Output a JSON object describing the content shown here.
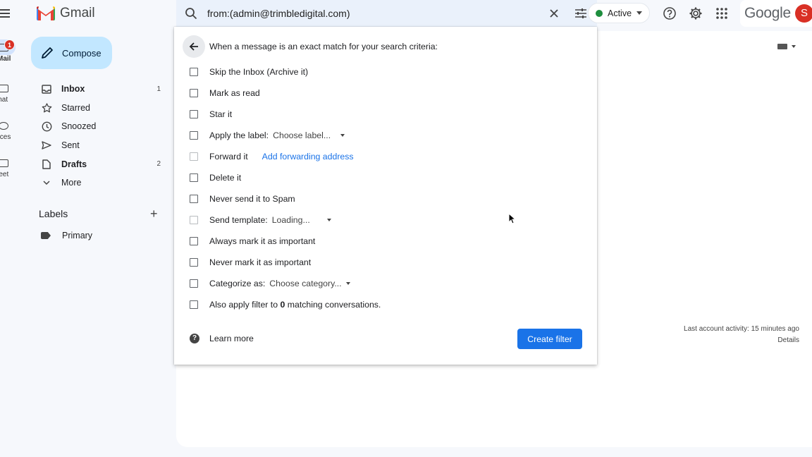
{
  "rail": {
    "mail_label": "Mail",
    "mail_badge": "1",
    "chat_label": "Chat",
    "spaces_label": "Spaces",
    "meet_label": "Meet"
  },
  "app": {
    "name": "Gmail"
  },
  "compose": {
    "label": "Compose"
  },
  "nav": [
    {
      "label": "Inbox",
      "count": "1",
      "icon": "inbox-icon"
    },
    {
      "label": "Starred",
      "count": "",
      "icon": "star-icon"
    },
    {
      "label": "Snoozed",
      "count": "",
      "icon": "clock-icon"
    },
    {
      "label": "Sent",
      "count": "",
      "icon": "send-icon"
    },
    {
      "label": "Drafts",
      "count": "2",
      "icon": "draft-icon"
    },
    {
      "label": "More",
      "count": "",
      "icon": "chevron-down-icon"
    }
  ],
  "labels": {
    "heading": "Labels",
    "items": [
      "Primary"
    ]
  },
  "search": {
    "value": "from:(admin@trimbledigital.com)"
  },
  "status": {
    "label": "Active"
  },
  "brand": {
    "google": "Google",
    "avatar_initial": "S"
  },
  "filter": {
    "title": "When a message is an exact match for your search criteria:",
    "options": {
      "skip_inbox": "Skip the Inbox (Archive it)",
      "mark_read": "Mark as read",
      "star": "Star it",
      "apply_label": "Apply the label:",
      "apply_label_value": "Choose label...",
      "forward": "Forward it",
      "forward_link": "Add forwarding address",
      "delete": "Delete it",
      "never_spam": "Never send it to Spam",
      "send_template": "Send template:",
      "send_template_value": "Loading...",
      "always_important": "Always mark it as important",
      "never_important": "Never mark it as important",
      "categorize": "Categorize as:",
      "categorize_value": "Choose category...",
      "also_apply_pre": "Also apply filter to ",
      "also_apply_count": "0",
      "also_apply_post": " matching conversations."
    },
    "learn_more": "Learn more",
    "create_button": "Create filter"
  },
  "activity": {
    "line1": "Last account activity: 15 minutes ago",
    "details": "Details"
  },
  "colors": {
    "accent": "#1a73e8",
    "compose_bg": "#c2e7ff",
    "active_dot": "#1e8e3e",
    "avatar": "#d93025"
  }
}
